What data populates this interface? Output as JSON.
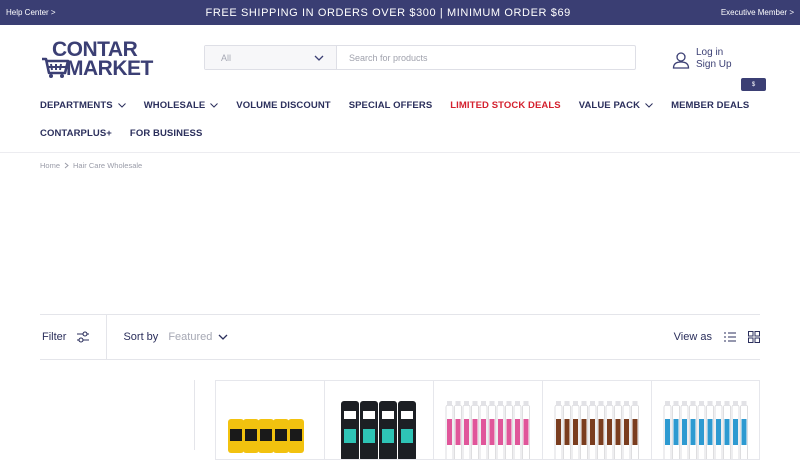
{
  "topbar": {
    "help": "Help Center >",
    "promo": "FREE SHIPPING IN ORDERS OVER $300 | MINIMUM ORDER $69",
    "member": "Executive Member >"
  },
  "logo": {
    "line1": "CONTAR",
    "line2": "MARKET"
  },
  "search": {
    "category": "All",
    "placeholder": "Search for products"
  },
  "account": {
    "login": "Log in",
    "signup": "Sign Up",
    "currency": "$"
  },
  "nav": {
    "row1": [
      {
        "label": "DEPARTMENTS",
        "chevron": true
      },
      {
        "label": "WHOLESALE",
        "chevron": true
      },
      {
        "label": "VOLUME DISCOUNT",
        "chevron": false
      },
      {
        "label": "SPECIAL OFFERS",
        "chevron": false
      },
      {
        "label": "LIMITED STOCK DEALS",
        "chevron": false,
        "color": "#d4202e"
      },
      {
        "label": "VALUE PACK",
        "chevron": true
      },
      {
        "label": "MEMBER DEALS",
        "chevron": false
      }
    ],
    "row2": [
      {
        "label": "CONTARPLUS+",
        "chevron": false
      },
      {
        "label": "FOR BUSINESS",
        "chevron": false
      }
    ]
  },
  "breadcrumb": {
    "home": "Home",
    "current": "Hair Care Wholesale"
  },
  "toolbar": {
    "filter": "Filter",
    "sort_label": "Sort by",
    "sort_value": "Featured",
    "view_as": "View as"
  },
  "products": [
    {
      "name": "product-yellow-jars",
      "color": "#f2c20f"
    },
    {
      "name": "product-axe-black",
      "color": "#1c1f24"
    },
    {
      "name": "product-pink-cans",
      "color": "#e0569a"
    },
    {
      "name": "product-brown-cans",
      "color": "#7a3d1f"
    },
    {
      "name": "product-blue-cans",
      "color": "#2d9ad1"
    }
  ],
  "colors": {
    "brand": "#3b3f74",
    "topbar": "#3a3e73",
    "sale": "#d4202e"
  }
}
